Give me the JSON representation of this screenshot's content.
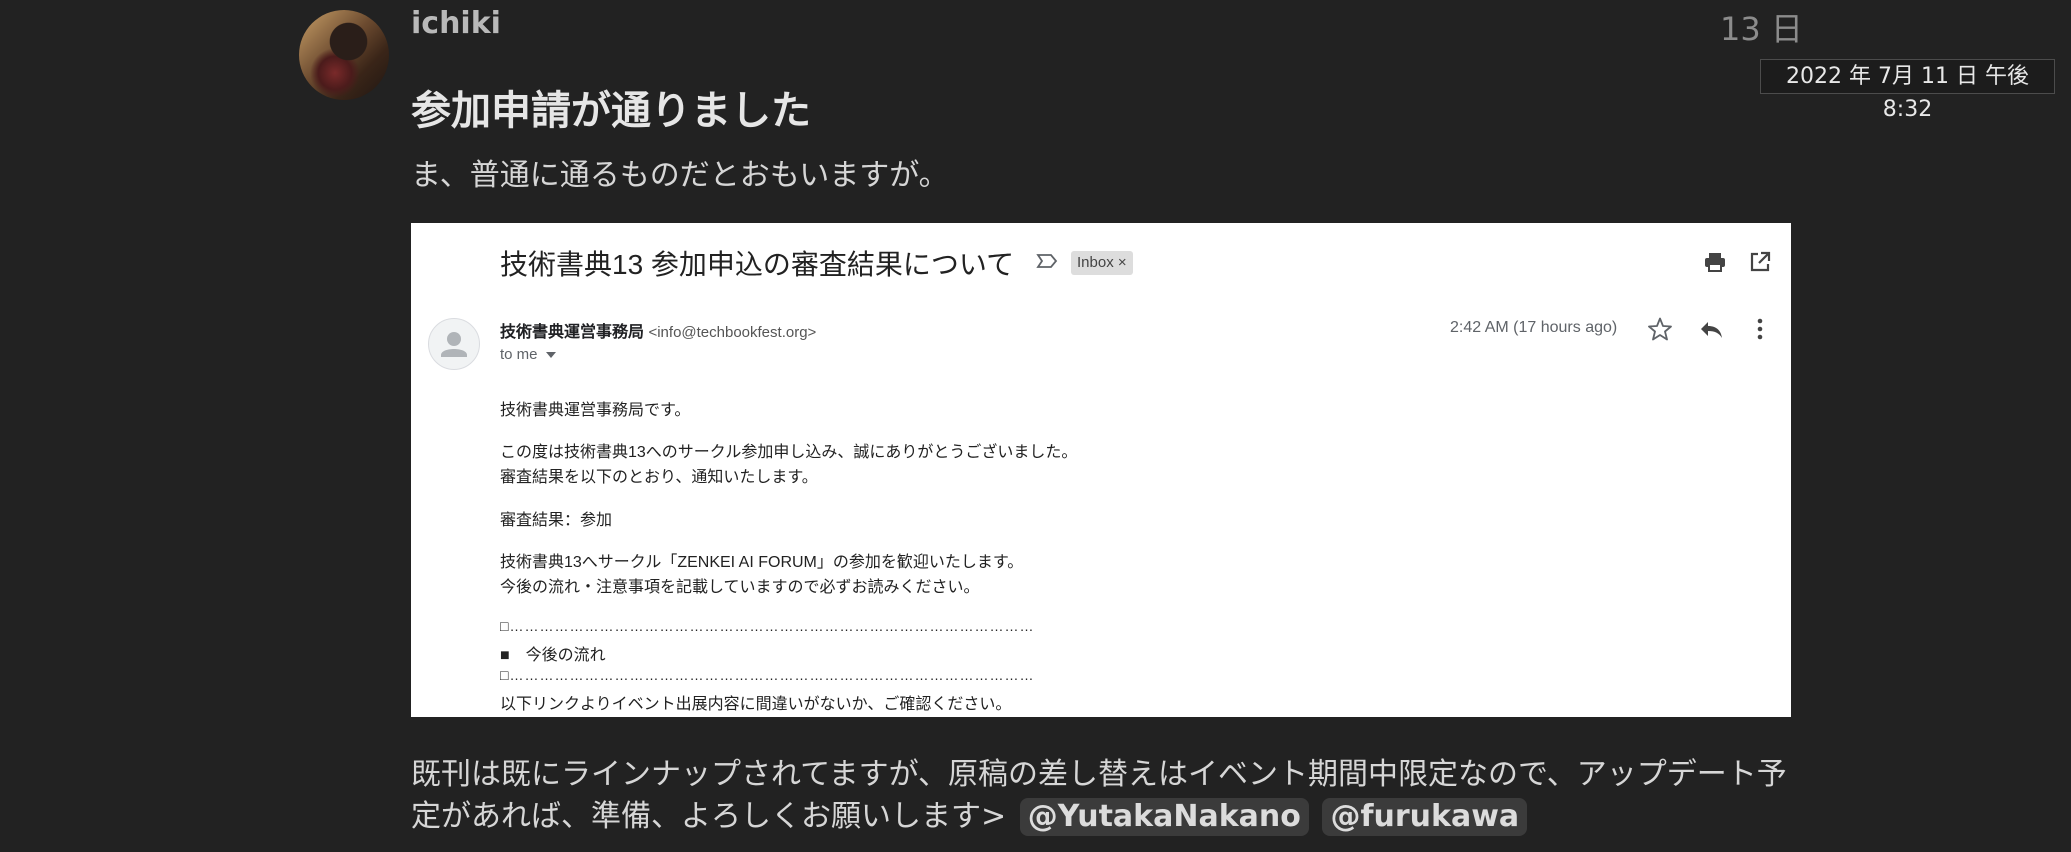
{
  "post": {
    "author": "ichiki",
    "date": "13 日",
    "tooltip": "2022 年 7月 11 日 午後 8:32",
    "title": "参加申請が通りました",
    "subtitle": "ま、普通に通るものだとおもいますが。"
  },
  "email": {
    "subject": "技術書典13 参加申込の審査結果について",
    "label": "Inbox ×",
    "sender_name": "技術書典運営事務局",
    "sender_email": "<info@techbookfest.org>",
    "to": "to me",
    "time": "2:42 AM (17 hours ago)",
    "lines": [
      "技術書典運営事務局です。",
      "この度は技術書典13へのサークル参加申し込み、誠にありがとうございました。",
      "審査結果を以下のとおり、通知いたします。",
      "審査結果：参加",
      "技術書典13へサークル「ZENKEI AI FORUM」の参加を歓迎いたします。",
      "今後の流れ・注意事項を記載していますので必ずお読みください。",
      "□……………………………………………………………………………………………",
      "■　今後の流れ",
      "□……………………………………………………………………………………………",
      "以下リンクよりイベント出展内容に間違いがないか、ご確認ください。"
    ]
  },
  "comment": {
    "text": "既刊は既にラインナップされてますが、原稿の差し替えはイベント期間中限定なので、アップデート予定があれば、準備、よろしくお願いします>",
    "mentions": [
      "@YutakaNakano",
      "@furukawa"
    ]
  },
  "colors": {
    "background": "#222222",
    "mention_bg": "#3b3b3b"
  }
}
